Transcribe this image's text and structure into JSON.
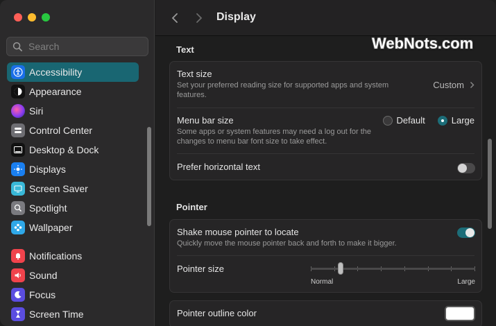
{
  "window": {
    "title": "Display"
  },
  "search": {
    "placeholder": "Search"
  },
  "watermark": "WebNots.com",
  "sidebar": {
    "items": [
      {
        "label": "Accessibility",
        "icon": "accessibility-icon",
        "color": "#1a6fe8",
        "active": true
      },
      {
        "label": "Appearance",
        "icon": "appearance-icon",
        "color": "#111111",
        "active": false
      },
      {
        "label": "Siri",
        "icon": "siri-icon",
        "color": "#a050e0",
        "active": false
      },
      {
        "label": "Control Center",
        "icon": "control-center-icon",
        "color": "#6e6e73",
        "active": false
      },
      {
        "label": "Desktop & Dock",
        "icon": "desktop-dock-icon",
        "color": "#111111",
        "active": false
      },
      {
        "label": "Displays",
        "icon": "displays-icon",
        "color": "#1a7ff0",
        "active": false
      },
      {
        "label": "Screen Saver",
        "icon": "screen-saver-icon",
        "color": "#39b8d8",
        "active": false
      },
      {
        "label": "Spotlight",
        "icon": "spotlight-icon",
        "color": "#7a7a7f",
        "active": false
      },
      {
        "label": "Wallpaper",
        "icon": "wallpaper-icon",
        "color": "#2fa8e8",
        "active": false
      },
      {
        "label": "Notifications",
        "icon": "notifications-icon",
        "color": "#f0434c",
        "active": false
      },
      {
        "label": "Sound",
        "icon": "sound-icon",
        "color": "#f0434c",
        "active": false
      },
      {
        "label": "Focus",
        "icon": "focus-icon",
        "color": "#5b4de0",
        "active": false
      },
      {
        "label": "Screen Time",
        "icon": "screen-time-icon",
        "color": "#5b4de0",
        "active": false
      }
    ]
  },
  "text_section": {
    "title": "Text",
    "text_size": {
      "label": "Text size",
      "desc": "Set your preferred reading size for supported apps and system features.",
      "value": "Custom"
    },
    "menu_bar_size": {
      "label": "Menu bar size",
      "desc": "Some apps or system features may need a log out for the changes to menu bar font size to take effect.",
      "options": [
        "Default",
        "Large"
      ],
      "selected": "Large"
    },
    "prefer_horizontal": {
      "label": "Prefer horizontal text",
      "on": false
    }
  },
  "pointer_section": {
    "title": "Pointer",
    "shake": {
      "label": "Shake mouse pointer to locate",
      "desc": "Quickly move the mouse pointer back and forth to make it bigger.",
      "on": true
    },
    "pointer_size": {
      "label": "Pointer size",
      "min_label": "Normal",
      "max_label": "Large",
      "value": 0.17
    },
    "outline_color": {
      "label": "Pointer outline color",
      "color": "#ffffff"
    }
  },
  "colors": {
    "accent": "#196672",
    "toggle_on": "#1c6d78"
  }
}
